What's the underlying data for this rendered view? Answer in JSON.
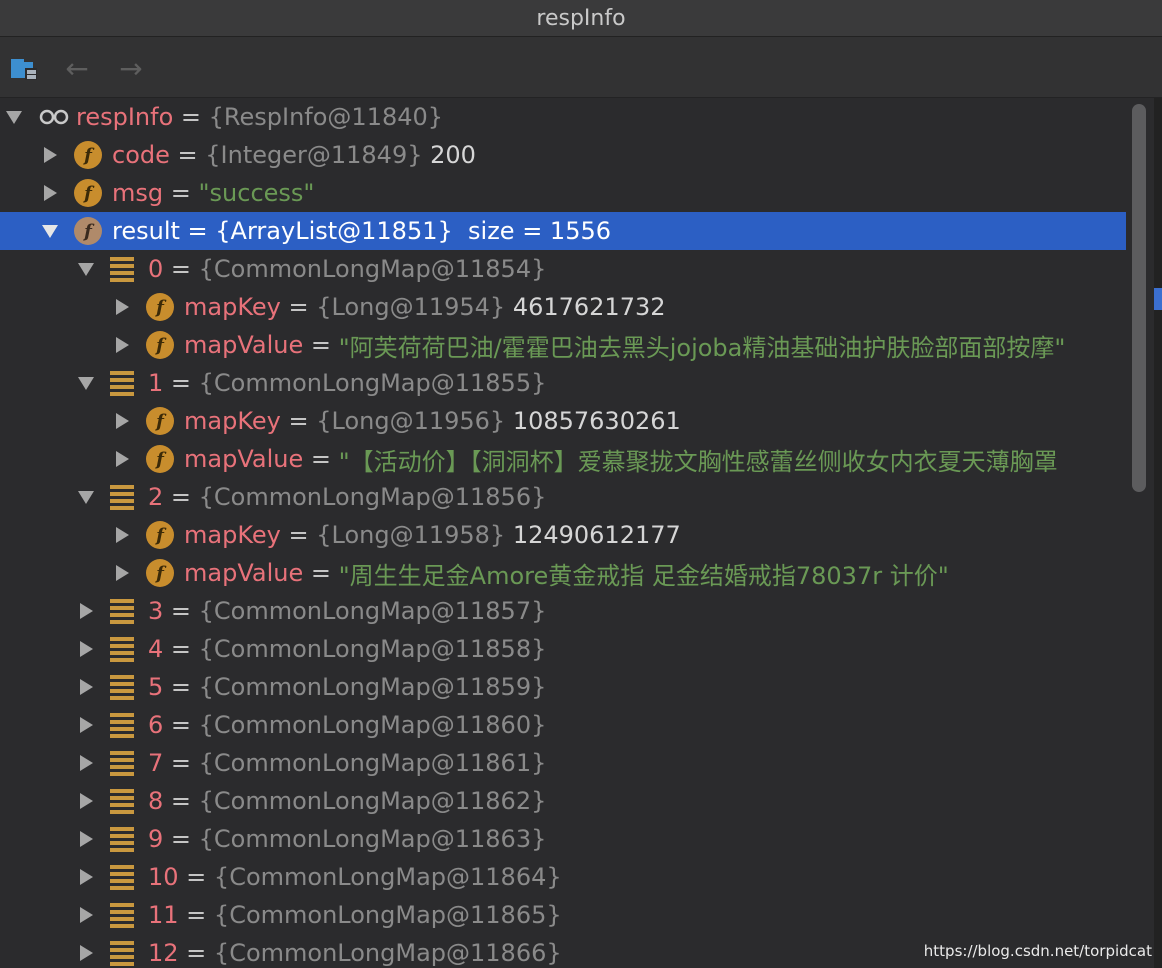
{
  "window": {
    "title": "respInfo"
  },
  "toolbar": {
    "back": "←",
    "forward": "→"
  },
  "tree": [
    {
      "arrow": "down",
      "icon": "watch",
      "level": 0,
      "name": "respInfo",
      "eq": "=",
      "obj": "{RespInfo@11840}"
    },
    {
      "arrow": "right",
      "icon": "field",
      "level": 1,
      "name": "code",
      "eq": "=",
      "obj": "{Integer@11849}",
      "val": "200"
    },
    {
      "arrow": "right",
      "icon": "field",
      "level": 1,
      "name": "msg",
      "eq": "=",
      "str": "\"success\""
    },
    {
      "arrow": "down",
      "icon": "field",
      "level": 1,
      "name": "result",
      "eq": "=",
      "obj": "{ArrayList@11851}",
      "val": " size = 1556",
      "selected": true
    },
    {
      "arrow": "down",
      "icon": "list",
      "level": 2,
      "name": "0",
      "eq": "=",
      "obj": "{CommonLongMap@11854}"
    },
    {
      "arrow": "right",
      "icon": "field",
      "level": 3,
      "name": "mapKey",
      "eq": "=",
      "obj": "{Long@11954}",
      "val": "4617621732"
    },
    {
      "arrow": "right",
      "icon": "field",
      "level": 3,
      "name": "mapValue",
      "eq": "=",
      "str": "\"阿芙荷荷巴油/霍霍巴油去黑头jojoba精油基础油护肤脸部面部按摩\""
    },
    {
      "arrow": "down",
      "icon": "list",
      "level": 2,
      "name": "1",
      "eq": "=",
      "obj": "{CommonLongMap@11855}"
    },
    {
      "arrow": "right",
      "icon": "field",
      "level": 3,
      "name": "mapKey",
      "eq": "=",
      "obj": "{Long@11956}",
      "val": "10857630261"
    },
    {
      "arrow": "right",
      "icon": "field",
      "level": 3,
      "name": "mapValue",
      "eq": "=",
      "str": "\"【活动价】【洞洞杯】爱慕聚拢文胸性感蕾丝侧收女内衣夏天薄胸罩"
    },
    {
      "arrow": "down",
      "icon": "list",
      "level": 2,
      "name": "2",
      "eq": "=",
      "obj": "{CommonLongMap@11856}"
    },
    {
      "arrow": "right",
      "icon": "field",
      "level": 3,
      "name": "mapKey",
      "eq": "=",
      "obj": "{Long@11958}",
      "val": "12490612177"
    },
    {
      "arrow": "right",
      "icon": "field",
      "level": 3,
      "name": "mapValue",
      "eq": "=",
      "str": "\"周生生足金Amore黄金戒指 足金结婚戒指78037r  计价\""
    },
    {
      "arrow": "right",
      "icon": "list",
      "level": 2,
      "name": "3",
      "eq": "=",
      "obj": "{CommonLongMap@11857}"
    },
    {
      "arrow": "right",
      "icon": "list",
      "level": 2,
      "name": "4",
      "eq": "=",
      "obj": "{CommonLongMap@11858}"
    },
    {
      "arrow": "right",
      "icon": "list",
      "level": 2,
      "name": "5",
      "eq": "=",
      "obj": "{CommonLongMap@11859}"
    },
    {
      "arrow": "right",
      "icon": "list",
      "level": 2,
      "name": "6",
      "eq": "=",
      "obj": "{CommonLongMap@11860}"
    },
    {
      "arrow": "right",
      "icon": "list",
      "level": 2,
      "name": "7",
      "eq": "=",
      "obj": "{CommonLongMap@11861}"
    },
    {
      "arrow": "right",
      "icon": "list",
      "level": 2,
      "name": "8",
      "eq": "=",
      "obj": "{CommonLongMap@11862}"
    },
    {
      "arrow": "right",
      "icon": "list",
      "level": 2,
      "name": "9",
      "eq": "=",
      "obj": "{CommonLongMap@11863}"
    },
    {
      "arrow": "right",
      "icon": "list",
      "level": 2,
      "name": "10",
      "eq": "=",
      "obj": "{CommonLongMap@11864}"
    },
    {
      "arrow": "right",
      "icon": "list",
      "level": 2,
      "name": "11",
      "eq": "=",
      "obj": "{CommonLongMap@11865}"
    },
    {
      "arrow": "right",
      "icon": "list",
      "level": 2,
      "name": "12",
      "eq": "=",
      "obj": "{CommonLongMap@11866}"
    }
  ],
  "watermark": "https://blog.csdn.net/torpidcat",
  "colors": {
    "background": "#2b2b2d",
    "selection": "#2c5fc4",
    "name": "#e8727a",
    "string": "#6a9955",
    "field_icon": "#c88d2d"
  }
}
